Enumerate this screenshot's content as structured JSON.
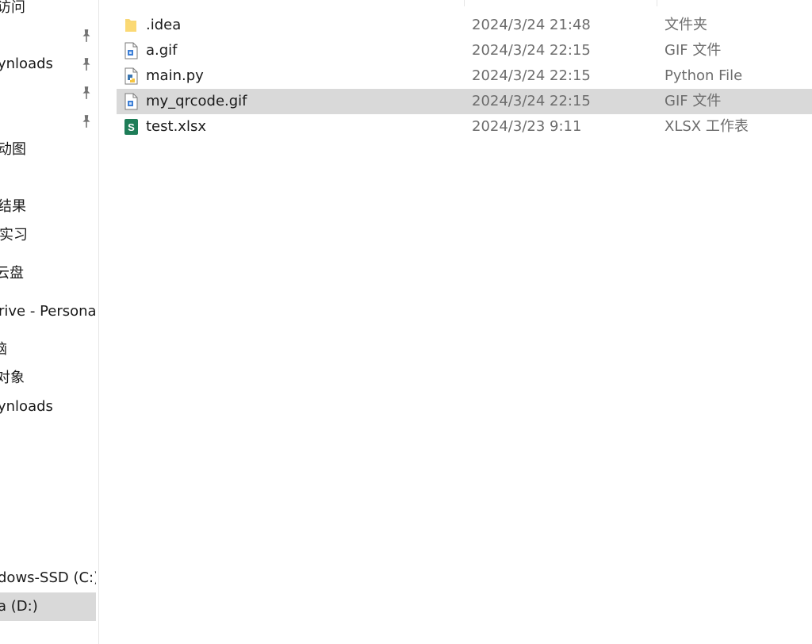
{
  "sidebar": {
    "items": [
      {
        "label": "访问"
      },
      {
        "label": ""
      },
      {
        "label": "ynloads"
      },
      {
        "label": ""
      },
      {
        "label": ""
      },
      {
        "label": "动图"
      },
      {
        "label": "结果"
      },
      {
        "label": "实习"
      },
      {
        "label": "云盘"
      },
      {
        "label": "rive - Personal"
      },
      {
        "label": "脑"
      },
      {
        "label": "对象"
      },
      {
        "label": "ynloads"
      },
      {
        "label": "dows-SSD (C:)"
      },
      {
        "label": "a (D:)"
      }
    ]
  },
  "files": [
    {
      "name": ".idea",
      "date": "2024/3/24 21:48",
      "type": "文件夹",
      "icon": "folder-icon"
    },
    {
      "name": "a.gif",
      "date": "2024/3/24 22:15",
      "type": "GIF 文件",
      "icon": "gif-file-icon"
    },
    {
      "name": "main.py",
      "date": "2024/3/24 22:15",
      "type": "Python File",
      "icon": "python-file-icon"
    },
    {
      "name": "my_qrcode.gif",
      "date": "2024/3/24 22:15",
      "type": "GIF 文件",
      "icon": "gif-file-icon"
    },
    {
      "name": "test.xlsx",
      "date": "2024/3/23 9:11",
      "type": "XLSX 工作表",
      "icon": "xlsx-file-icon"
    }
  ],
  "selected_file": "my_qrcode.gif",
  "selected_drive": "a (D:)"
}
